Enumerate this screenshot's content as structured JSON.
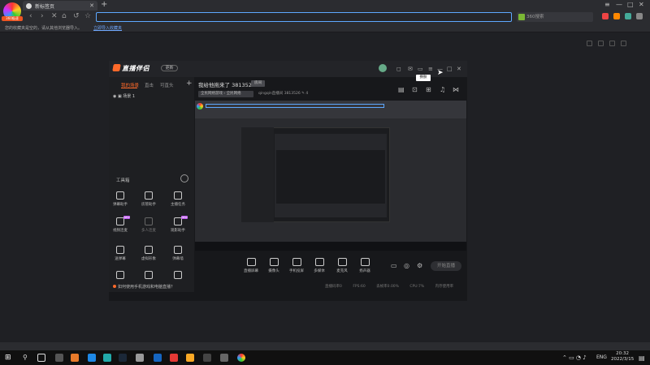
{
  "browser": {
    "tab_title": "新标签页",
    "tab_close": "✕",
    "new_tab": "+",
    "logo_badge": "360极速",
    "address_value": "",
    "search_placeholder": "360搜索",
    "bookmark_hint": "您的收藏夹是空的，请从其他浏览器导入。",
    "bookmark_import": "立即导入收藏夹",
    "nav": {
      "back": "‹",
      "forward": "›",
      "stop": "✕",
      "home": "⌂",
      "undo": "↺",
      "star": "☆"
    },
    "window_controls": {
      "menu": "≡",
      "minimize": "—",
      "maximize": "□",
      "close": "✕"
    }
  },
  "app": {
    "logo_text": "直播伴侣",
    "version": "更新",
    "tooltip": "换肤",
    "left_tabs": [
      "我的场景",
      "直击",
      "可直头"
    ],
    "left_add": "+",
    "scene_name": "场景 1",
    "tools_title": "工具箱",
    "tools": [
      {
        "label": "弹幕助手",
        "icon": "danmaku-icon"
      },
      {
        "label": "房管助手",
        "icon": "admin-icon"
      },
      {
        "label": "主播任务",
        "icon": "task-icon"
      },
      {
        "label": "视频连麦",
        "icon": "video-call-icon",
        "hot": "NEW"
      },
      {
        "label": "多人连麦",
        "icon": "multi-call-icon",
        "dim": true
      },
      {
        "label": "观影助手",
        "icon": "movie-icon",
        "hot": "NEW"
      },
      {
        "label": "送弹幕",
        "icon": "gift-icon"
      },
      {
        "label": "虚拟形象",
        "icon": "avatar-icon"
      },
      {
        "label": "弹幕墙",
        "icon": "wall-icon"
      },
      {
        "label": "",
        "icon": "more-icon"
      },
      {
        "label": "",
        "icon": "pk-icon"
      },
      {
        "label": "",
        "icon": "upload-icon"
      }
    ],
    "footer_tip": "如何使用手机游戏和电脑直播？",
    "live_title": "我给他拖来了 3813526",
    "live_tag": "房间",
    "category_tag": "全民网络游戏 › 全民网络",
    "live_sub": "qingqin直播间  3813526  ✎ 4",
    "controls": [
      {
        "label": "直播屏幕",
        "icon": "screen-icon"
      },
      {
        "label": "摄像头",
        "icon": "camera-icon"
      },
      {
        "label": "手机投屏",
        "icon": "phone-icon"
      },
      {
        "label": "多媒体",
        "icon": "media-icon"
      },
      {
        "label": "麦克风",
        "icon": "mic-icon"
      },
      {
        "label": "扬声器",
        "icon": "speaker-icon"
      }
    ],
    "go_live": "开始直播",
    "status": [
      "直播码率0",
      "FPS:60",
      "丢帧率0.00%",
      "CPU:7%",
      "内存使用率"
    ]
  },
  "taskbar": {
    "lang": "ENG",
    "time": "20:32",
    "date": "2022/3/15"
  }
}
